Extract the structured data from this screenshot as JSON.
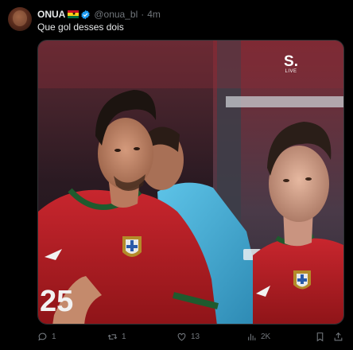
{
  "post": {
    "author_name": "ONUA",
    "handle": "@onua_bl",
    "separator": "·",
    "time_ago": "4m",
    "text": "Que gol desses dois"
  },
  "media": {
    "broadcaster_logo": "S.",
    "broadcaster_sub": "LIVE"
  },
  "actions": {
    "replies": "1",
    "reposts": "1",
    "likes": "13",
    "views": "2K"
  },
  "colors": {
    "background": "#000000",
    "text_primary": "#e7e9ea",
    "text_secondary": "#71767b",
    "verified_blue": "#1d9bf0",
    "border": "#2f3336"
  },
  "icons": [
    "verified-badge-icon",
    "ghana-flag-icon",
    "reply-icon",
    "repost-icon",
    "like-icon",
    "views-icon",
    "bookmark-icon",
    "share-icon"
  ]
}
